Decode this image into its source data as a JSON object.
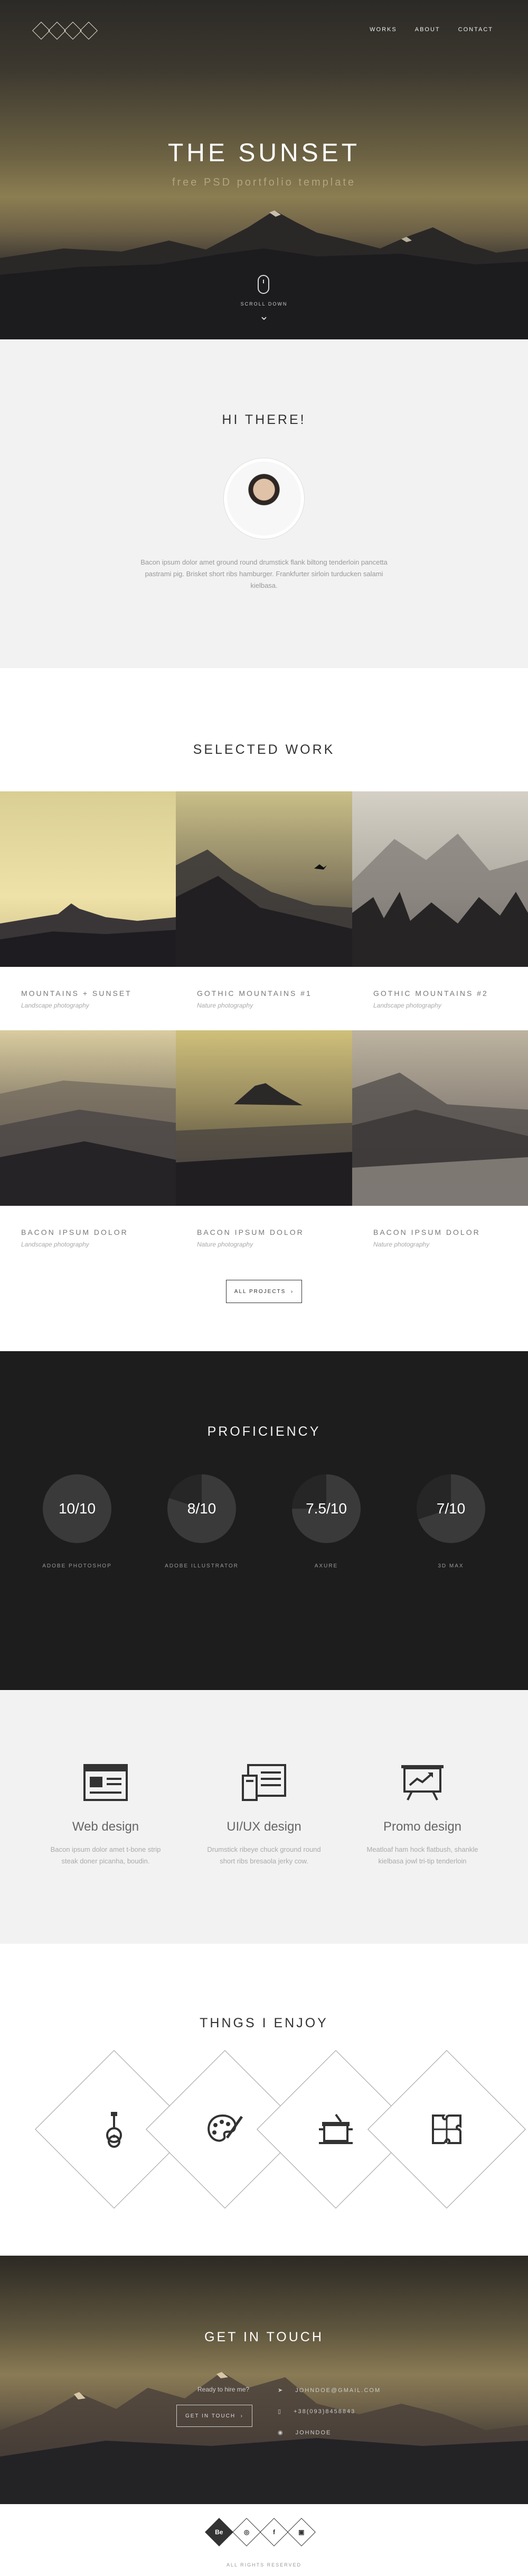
{
  "nav": {
    "logo_letters": [
      "",
      "",
      "",
      ""
    ],
    "items": [
      "WORKS",
      "ABOUT",
      "CONTACT"
    ]
  },
  "hero": {
    "title": "THE SUNSET",
    "subtitle": "free PSD portfolio template",
    "scroll_label": "SCROLL DOWN"
  },
  "hi": {
    "title": "HI THERE!",
    "text": "Bacon ipsum dolor amet ground round drumstick flank biltong tenderloin pancetta pastrami pig. Brisket short ribs hamburger. Frankfurter sirloin turducken salami kielbasa."
  },
  "work": {
    "title": "SELECTED WORK",
    "items": [
      {
        "title": "MOUNTAINS + SUNSET",
        "sub": "Landscape photography"
      },
      {
        "title": "GOTHIC MOUNTAINS #1",
        "sub": "Nature photography"
      },
      {
        "title": "GOTHIC MOUNTAINS #2",
        "sub": "Landscape photography"
      },
      {
        "title": "BACON IPSUM DOLOR",
        "sub": "Landscape photography"
      },
      {
        "title": "BACON IPSUM DOLOR",
        "sub": "Nature photography"
      },
      {
        "title": "BACON IPSUM DOLOR",
        "sub": "Nature photography"
      }
    ],
    "all_button": "ALL PROJECTS"
  },
  "proficiency": {
    "title": "PROFICIENCY",
    "skills": [
      {
        "value": "10/10",
        "label": "ADOBE PHOTOSHOP",
        "level": 1.0
      },
      {
        "value": "8/10",
        "label": "ADOBE ILLUSTRATOR",
        "level": 0.8
      },
      {
        "value": "7.5/10",
        "label": "AXURE",
        "level": 0.75
      },
      {
        "value": "7/10",
        "label": "3D MAX",
        "level": 0.7
      }
    ]
  },
  "services": [
    {
      "name": "Web design",
      "desc": "Bacon ipsum dolor amet t-bone strip steak doner picanha, boudin."
    },
    {
      "name": "UI/UX design",
      "desc": "Drumstick ribeye chuck ground round short ribs bresaola jerky cow."
    },
    {
      "name": "Promo design",
      "desc": "Meatloaf ham hock flatbush, shankle kielbasa jowl tri-tip tenderloin"
    }
  ],
  "enjoy": {
    "title": "THNGS I ENJOY",
    "icons": [
      "guitar-icon",
      "palette-icon",
      "cooking-pot-icon",
      "puzzle-icon"
    ]
  },
  "contact": {
    "title": "GET IN TOUCH",
    "ready": "Ready to hire me?",
    "button": "GET IN TOUCH",
    "email": "JOHNDOE@GMAIL.COM",
    "phone": "+38(093)8458843",
    "skype": "JOHNDOE"
  },
  "footer": {
    "socials": [
      "Be",
      "",
      "f",
      ""
    ],
    "copy": "ALL RIGHTS RESERVED"
  }
}
